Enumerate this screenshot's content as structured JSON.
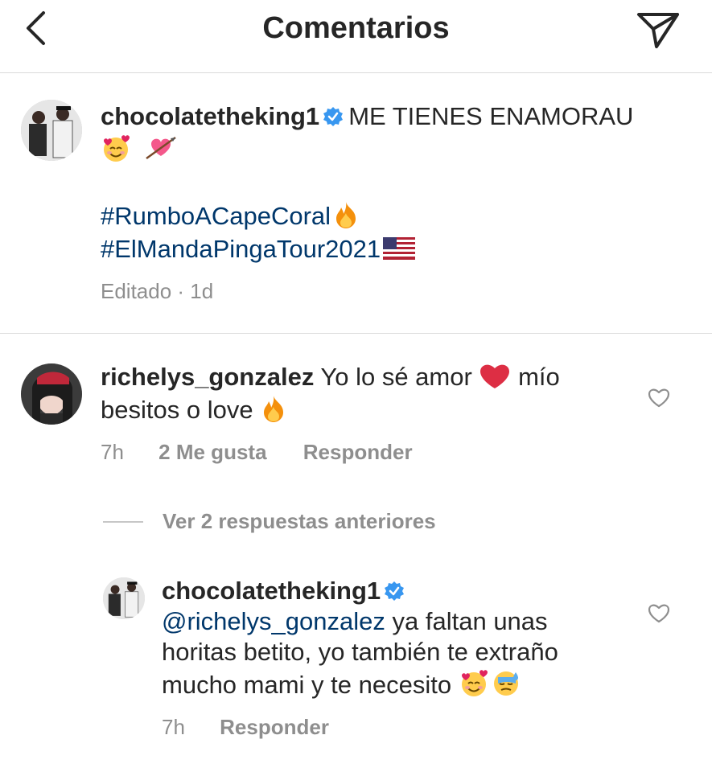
{
  "header": {
    "title": "Comentarios"
  },
  "caption": {
    "username": "chocolatetheking1",
    "text_line1": "ME TIENES ENAMORAU",
    "hashtag1": "#RumboACapeCoral",
    "hashtag2": "#ElMandaPingaTour2021",
    "meta": "Editado · 1d"
  },
  "comment": {
    "username": "richelys_gonzalez",
    "text_part1": "Yo lo sé amor",
    "text_part2": "mío",
    "text_line2": "besitos o love",
    "time": "7h",
    "likes": "2 Me gusta",
    "reply": "Responder"
  },
  "view_replies": "Ver 2 respuestas anteriores",
  "reply": {
    "username": "chocolatetheking1",
    "mention": "@richelys_gonzalez",
    "text_line1": "ya faltan unas",
    "text_line2": "horitas betito, yo también te extraño",
    "text_line3": "mucho mami y te necesito",
    "time": "7h",
    "reply": "Responder"
  },
  "icons": {
    "back": "chevron-left-icon",
    "send": "paper-plane-icon",
    "verified": "verified-badge-icon",
    "heart": "heart-outline-icon"
  },
  "colors": {
    "hashtag": "#00376b",
    "verified": "#3897f0",
    "meta": "#8e8e8e"
  }
}
